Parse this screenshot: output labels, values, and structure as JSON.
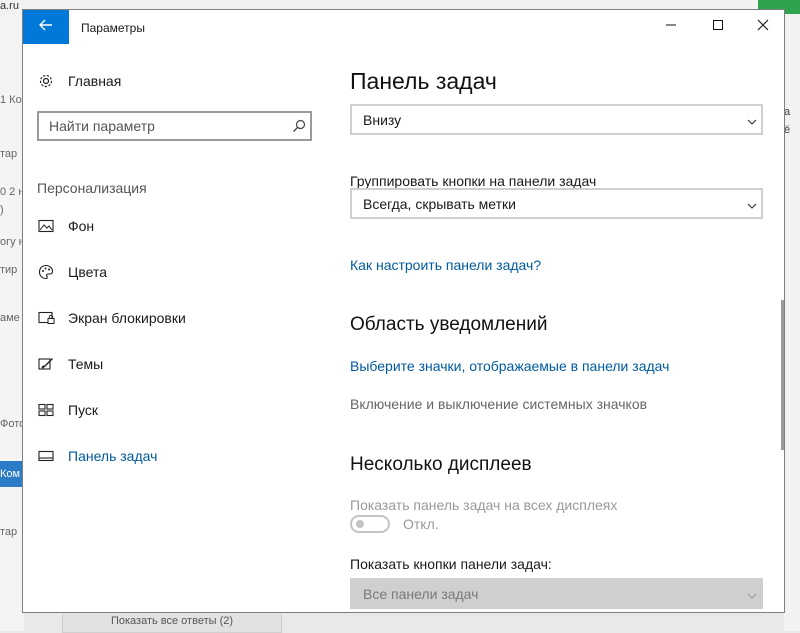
{
  "background": {
    "url_fragment": "a.ru",
    "left_fragments": [
      "1 Ко",
      "тар",
      "0 2 н",
      ")",
      "огу н",
      "тир",
      "аме",
      "Фото",
      "Ком",
      "тар"
    ],
    "right_fragments": [
      "а",
      "ё"
    ],
    "bottom_button": "Показать все ответы (2)"
  },
  "window": {
    "title": "Параметры"
  },
  "sidebar": {
    "home_label": "Главная",
    "search_placeholder": "Найти параметр",
    "section_title": "Персонализация",
    "items": [
      {
        "label": "Фон",
        "icon": "picture-icon"
      },
      {
        "label": "Цвета",
        "icon": "palette-icon"
      },
      {
        "label": "Экран блокировки",
        "icon": "lock-screen-icon"
      },
      {
        "label": "Темы",
        "icon": "themes-icon"
      },
      {
        "label": "Пуск",
        "icon": "start-icon"
      },
      {
        "label": "Панель задач",
        "icon": "taskbar-icon"
      }
    ]
  },
  "main": {
    "title": "Панель задач",
    "position_select_value": "Внизу",
    "group_label": "Группировать кнопки на панели задач",
    "group_select_value": "Всегда, скрывать метки",
    "help_link": "Как настроить панели задач?",
    "notify_title": "Область уведомлений",
    "notify_link": "Выберите значки, отображаемые в панели задач",
    "system_icons_text": "Включение и выключение системных значков",
    "multi_title": "Несколько дисплеев",
    "show_all_label": "Показать панель задач на всех дисплеях",
    "toggle_state": "Откл.",
    "show_buttons_label": "Показать кнопки панели задач:",
    "show_buttons_value": "Все панели задач"
  },
  "colors": {
    "accent": "#0078d7",
    "link": "#005a9e"
  }
}
